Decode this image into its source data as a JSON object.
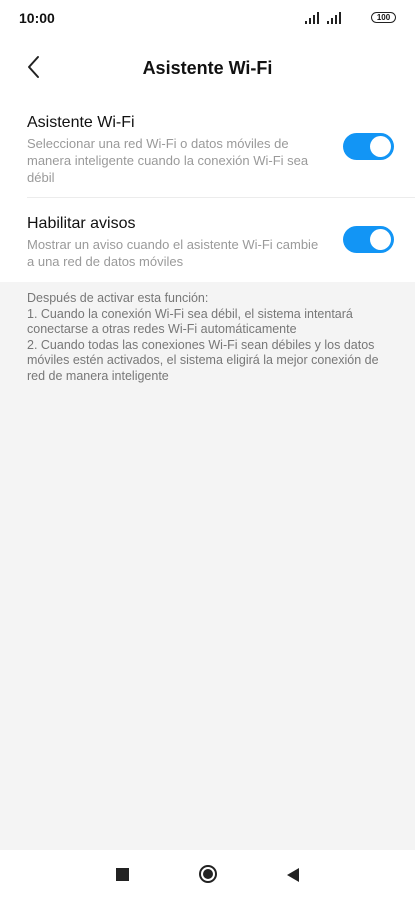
{
  "status_bar": {
    "time": "10:00",
    "battery": "100"
  },
  "header": {
    "title": "Asistente Wi-Fi",
    "back_icon": "chevron-left-icon"
  },
  "settings": [
    {
      "title": "Asistente Wi-Fi",
      "description": "Seleccionar una red Wi-Fi o datos móviles de manera inteligente cuando la conexión Wi-Fi sea débil",
      "enabled": true
    },
    {
      "title": "Habilitar avisos",
      "description": "Mostrar un aviso cuando el asistente Wi-Fi cambie a una red de datos móviles",
      "enabled": true
    }
  ],
  "info": {
    "lines": [
      "Después de activar esta función:",
      "1. Cuando la conexión Wi-Fi sea débil, el sistema intentará conectarse a otras redes Wi-Fi automáticamente",
      "2. Cuando todas las conexiones Wi-Fi sean débiles y los datos móviles estén activados, el sistema eligirá la mejor conexión de red de manera inteligente"
    ]
  },
  "colors": {
    "accent": "#1295f5",
    "background": "#f4f4f4",
    "card": "#ffffff",
    "secondary_text": "#9a9a9a"
  }
}
